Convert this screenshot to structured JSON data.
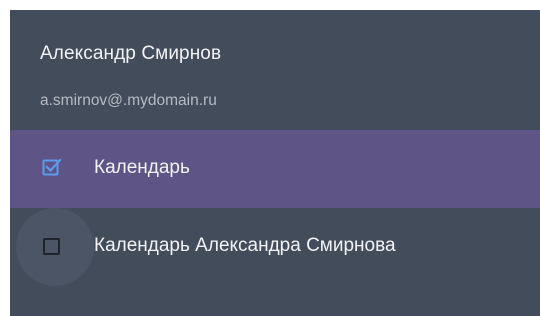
{
  "account": {
    "name": "Александр Смирнов",
    "email": "a.smirnov@.mydomain.ru"
  },
  "calendars": [
    {
      "label": "Календарь",
      "checked": true
    },
    {
      "label": "Календарь Александра Смирнова",
      "checked": false
    }
  ],
  "colors": {
    "panel_background": "#434c5a",
    "selected_row": "#5e5586",
    "checkbox_checked": "#5b9bf0"
  }
}
